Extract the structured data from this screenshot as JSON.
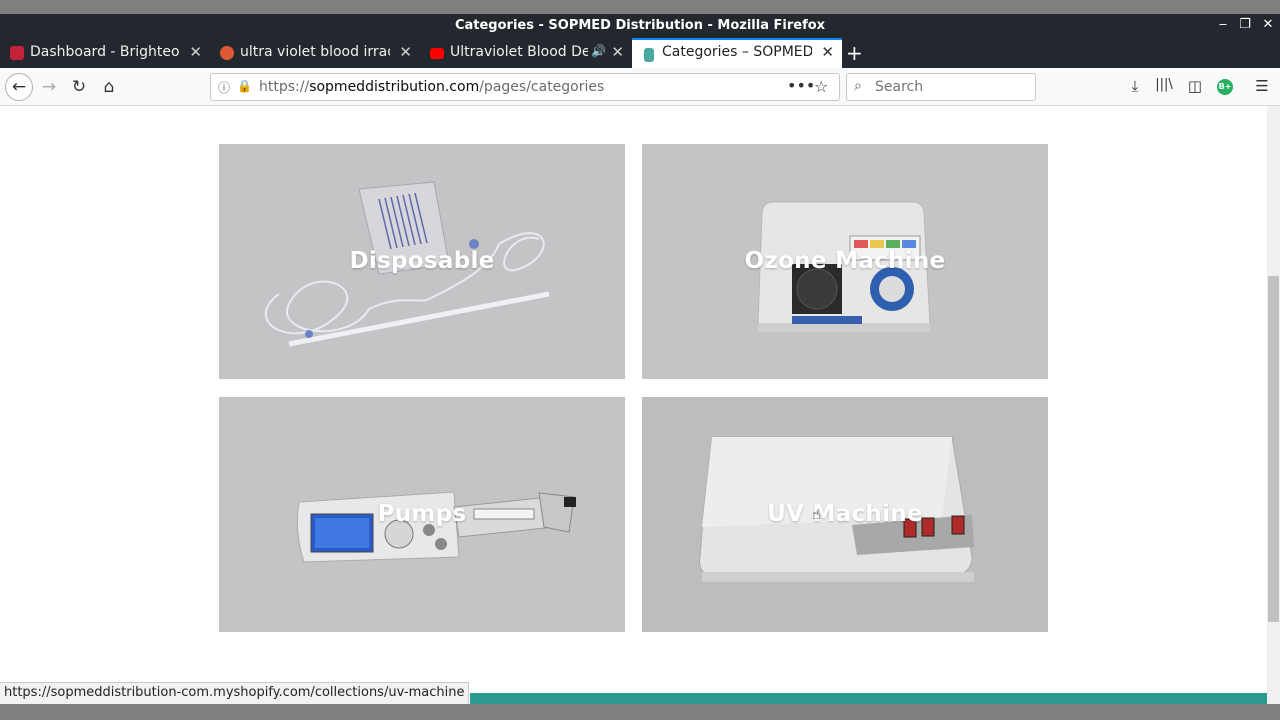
{
  "window": {
    "title": "Categories - SOPMED Distribution - Mozilla Firefox",
    "minimize": "‒",
    "maximize": "❐",
    "close": "✕"
  },
  "tabs": [
    {
      "label": "Dashboard - Brighteon",
      "favicon_color": "#c4213a",
      "close": "✕"
    },
    {
      "label": "ultra violet blood irradia",
      "favicon_color": "#de5833",
      "close": "✕"
    },
    {
      "label": "Ultraviolet Blood Dev",
      "favicon_color": "#ff0000",
      "close": "✕",
      "sound": "🔊"
    },
    {
      "label": "Categories – SOPMED D",
      "favicon_color": "#4aa8a0",
      "close": "✕",
      "active": true
    }
  ],
  "newtab_label": "+",
  "nav": {
    "back": "←",
    "forward": "→",
    "reload": "↻",
    "home": "⌂",
    "url_prefix": "https://",
    "url_domain": "sopmeddistribution.com",
    "url_path": "/pages/categories",
    "page_actions": "•••",
    "bookmark": "☆",
    "search_placeholder": "Search",
    "search_icon": "⌕",
    "downloads": "⤓",
    "library": "|||\\",
    "sidebar": "◫",
    "extension": "B+",
    "menu": "☰"
  },
  "categories": [
    {
      "label": "Disposable",
      "icon": "tubing-set-image"
    },
    {
      "label": "Ozone Machine",
      "icon": "ozone-generator-image"
    },
    {
      "label": "Pumps",
      "icon": "syringe-pump-image"
    },
    {
      "label": "UV Machine",
      "icon": "uv-machine-image"
    }
  ],
  "status_url": "https://sopmeddistribution-com.myshopify.com/collections/uv-machine",
  "colors": {
    "chrome_dark": "#22282e",
    "accent_tab": "#0a84ff",
    "footer_teal": "#2a9a8f",
    "card_bg": "#c4c4c6"
  }
}
